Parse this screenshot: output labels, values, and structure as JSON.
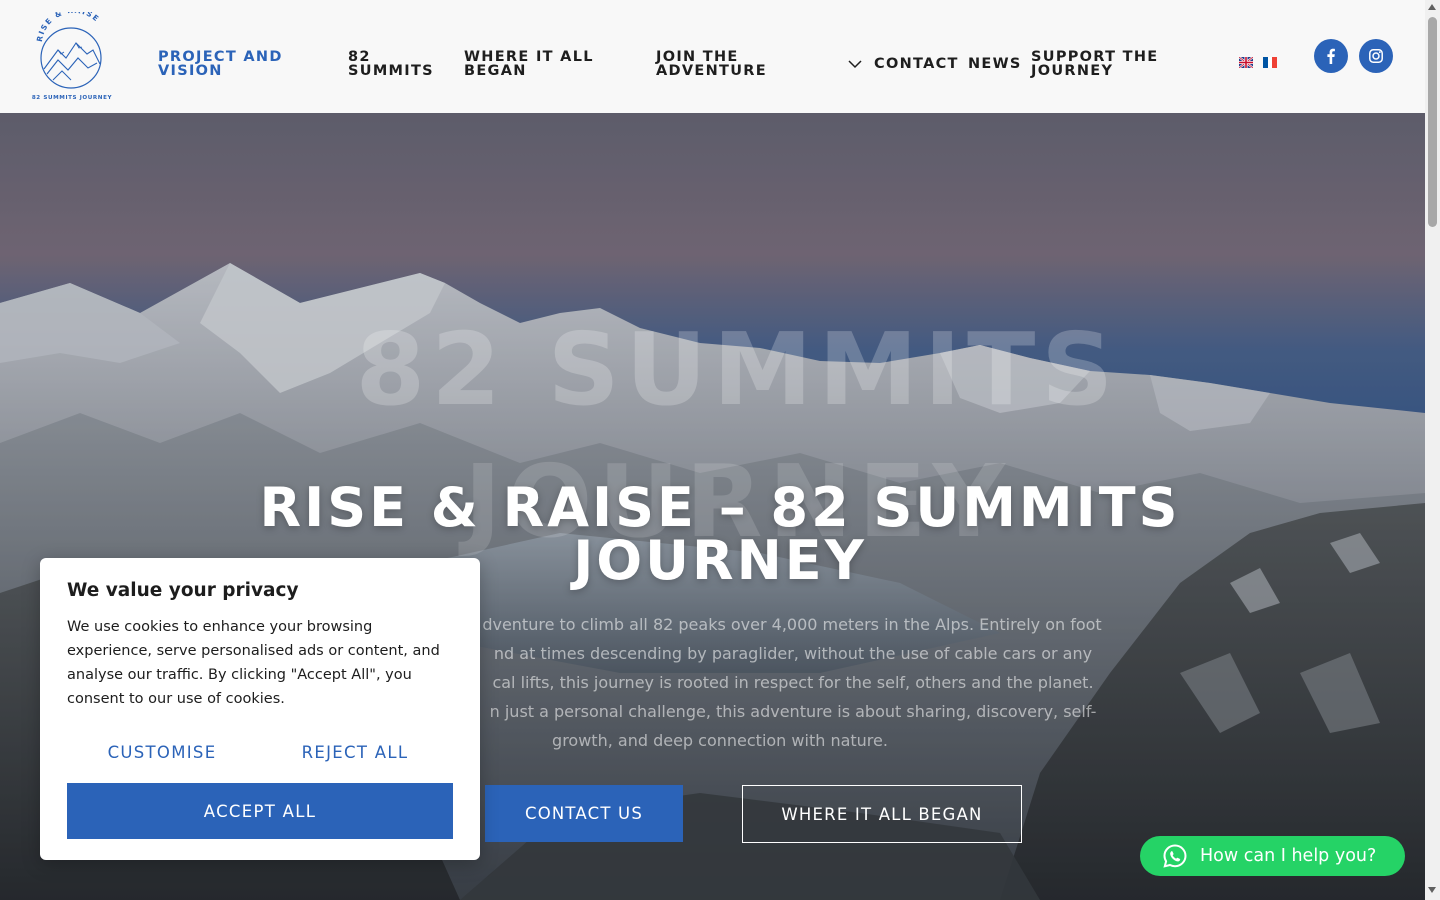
{
  "header": {
    "logo": {
      "arc_text": "RISE & RAISE",
      "caption": "82 SUMMITS JOURNEY"
    },
    "nav": [
      {
        "label": "PROJECT AND VISION",
        "active": true
      },
      {
        "label": "82 SUMMITS"
      },
      {
        "label": "WHERE IT ALL BEGAN"
      },
      {
        "label": "JOIN THE ADVENTURE",
        "has_dropdown": true
      },
      {
        "label": "CONTACT"
      },
      {
        "label": "NEWS"
      },
      {
        "label": "SUPPORT THE JOURNEY"
      }
    ],
    "languages": [
      {
        "code": "en",
        "icon": "uk-flag-icon"
      },
      {
        "code": "fr",
        "icon": "france-flag-icon"
      }
    ],
    "social": [
      {
        "name": "Facebook",
        "icon": "facebook-icon"
      },
      {
        "name": "Instagram",
        "icon": "instagram-icon"
      }
    ]
  },
  "hero": {
    "background_text_line1": "82 SUMMITS",
    "background_text_line2": "JOURNEY",
    "title": "RISE & RAISE – 82 SUMMITS JOURNEY",
    "description_lines": [
      "dventure to climb all 82 peaks over 4,000 meters in the Alps. Entirely on foot",
      "nd at times descending by paraglider, without the use of cable cars or any",
      "cal lifts, this journey is rooted in respect for the self, others and the planet.",
      "n just a personal challenge, this adventure is about sharing, discovery, self-",
      "growth, and deep connection with nature."
    ],
    "primary_button": "CONTACT US",
    "secondary_button": "WHERE IT ALL BEGAN"
  },
  "cookie_banner": {
    "title": "We value your privacy",
    "text": "We use cookies to enhance your browsing experience, serve personalised ads or content, and analyse our traffic. By clicking \"Accept All\", you consent to our use of cookies.",
    "customise": "CUSTOMISE",
    "reject": "REJECT ALL",
    "accept": "ACCEPT ALL"
  },
  "whatsapp": {
    "label": "How can I help you?",
    "icon": "whatsapp-icon"
  },
  "colors": {
    "brand_blue": "#2b63b8",
    "whatsapp_green": "#25d366",
    "header_bg": "#f8f8f8"
  }
}
